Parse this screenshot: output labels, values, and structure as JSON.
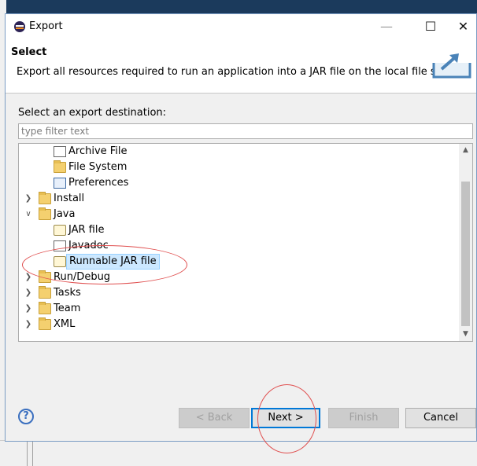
{
  "window": {
    "title": "Export",
    "minimize_glyph": "—",
    "maximize_glyph": "☐",
    "close_glyph": "✕"
  },
  "header": {
    "title": "Select",
    "description": "Export all resources required to run an application into a JAR file on the local file system."
  },
  "prompt": "Select an export destination:",
  "filter": {
    "placeholder": "type filter text",
    "value": ""
  },
  "tree": {
    "items": [
      {
        "label": "Archive File",
        "level": 1,
        "icon": "archive-file-icon"
      },
      {
        "label": "File System",
        "level": 1,
        "icon": "folder-icon"
      },
      {
        "label": "Preferences",
        "level": 1,
        "icon": "preferences-icon"
      },
      {
        "label": "Install",
        "level": 0,
        "icon": "folder-icon",
        "expanded": false
      },
      {
        "label": "Java",
        "level": 0,
        "icon": "folder-icon",
        "expanded": true
      },
      {
        "label": "JAR file",
        "level": 1,
        "icon": "jar-file-icon"
      },
      {
        "label": "Javadoc",
        "level": 1,
        "icon": "javadoc-icon"
      },
      {
        "label": "Runnable JAR file",
        "level": 1,
        "icon": "runnable-jar-icon",
        "selected": true
      },
      {
        "label": "Run/Debug",
        "level": 0,
        "icon": "folder-icon",
        "expanded": false
      },
      {
        "label": "Tasks",
        "level": 0,
        "icon": "folder-icon",
        "expanded": false
      },
      {
        "label": "Team",
        "level": 0,
        "icon": "folder-icon",
        "expanded": false
      },
      {
        "label": "XML",
        "level": 0,
        "icon": "folder-icon",
        "expanded": false
      }
    ]
  },
  "buttons": {
    "back": "< Back",
    "next": "Next >",
    "finish": "Finish",
    "cancel": "Cancel",
    "help": "?"
  },
  "colors": {
    "accent": "#0078d7",
    "selection": "#cce8ff",
    "annotation": "#e05050"
  }
}
